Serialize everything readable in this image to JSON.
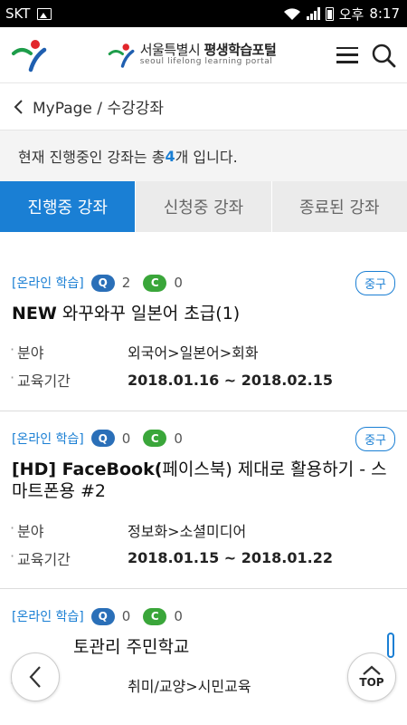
{
  "statusbar": {
    "carrier": "SKT",
    "ampm": "오후",
    "time": "8:17"
  },
  "header": {
    "brand_city": "서울특별시",
    "brand_name": "평생학습포털",
    "brand_sub": "seoul lifelong learning portal",
    "menu_icon": "hamburger-icon",
    "search_icon": "search-icon"
  },
  "breadcrumb": {
    "root": "MyPage",
    "separator": "/",
    "current": "수강강좌"
  },
  "notice": {
    "prefix": "현재 진행중인 강좌는 총 ",
    "count": "4",
    "suffix": "개 입니다."
  },
  "tabs": [
    {
      "label": "진행중 강좌",
      "active": true
    },
    {
      "label": "신청중 강좌",
      "active": false
    },
    {
      "label": "종료된 강좌",
      "active": false
    }
  ],
  "courses": [
    {
      "category": "[온라인 학습]",
      "q_label": "Q",
      "q_count": "2",
      "c_label": "C",
      "c_count": "0",
      "status": "중구",
      "title_bold": "NEW",
      "title_rest": " 와꾸와꾸 일본어 초급(1)",
      "field_label": "분야",
      "field_value": "외국어>일본어>회화",
      "period_label": "교육기간",
      "period_value": "2018.01.16 ~ 2018.02.15"
    },
    {
      "category": "[온라인 학습]",
      "q_label": "Q",
      "q_count": "0",
      "c_label": "C",
      "c_count": "0",
      "status": "중구",
      "title_bold": "[HD] FaceBook(",
      "title_rest": "페이스북) 제대로 활용하기 - 스마트폰용 #2",
      "field_label": "분야",
      "field_value": "정보화>소셜미디어",
      "period_label": "교육기간",
      "period_value": "2018.01.15 ~ 2018.01.22"
    },
    {
      "category": "[온라인 학습]",
      "q_label": "Q",
      "q_count": "0",
      "c_label": "C",
      "c_count": "0",
      "title_visible": "토관리 주민학교",
      "field_label": "분야",
      "field_value": "취미/교양>시민교육"
    }
  ],
  "fab": {
    "back_icon": "chevron-left-icon",
    "top_label": "TOP"
  },
  "colors": {
    "accent": "#1a7fd4",
    "q_badge": "#2a6fb8",
    "c_badge": "#3aa63a"
  }
}
